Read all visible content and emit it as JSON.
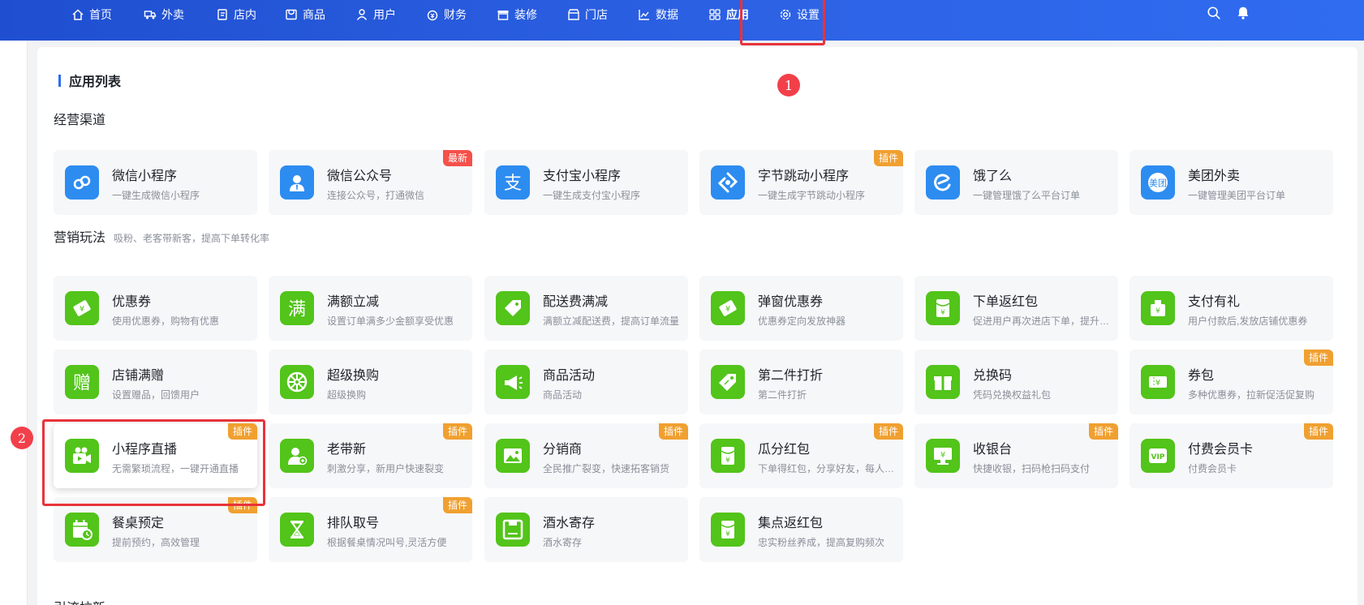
{
  "nav": {
    "items": [
      {
        "label": "首页",
        "icon": "home-icon"
      },
      {
        "label": "外卖",
        "icon": "delivery-icon"
      },
      {
        "label": "店内",
        "icon": "dine-in-icon"
      },
      {
        "label": "商品",
        "icon": "goods-icon"
      },
      {
        "label": "用户",
        "icon": "user-icon"
      },
      {
        "label": "财务",
        "icon": "finance-icon"
      },
      {
        "label": "装修",
        "icon": "decoration-icon"
      },
      {
        "label": "门店",
        "icon": "store-icon"
      },
      {
        "label": "数据",
        "icon": "chart-icon"
      },
      {
        "label": "应用",
        "icon": "apps-icon",
        "active": true
      },
      {
        "label": "设置",
        "icon": "settings-icon"
      }
    ],
    "right_icons": [
      "search-icon",
      "bell-icon"
    ]
  },
  "page": {
    "title": "应用列表"
  },
  "markers": [
    "1",
    "2"
  ],
  "sections": {
    "channels": {
      "title": "经营渠道",
      "subtitle": "",
      "cards": [
        {
          "title": "微信小程序",
          "desc": "一键生成微信小程序",
          "icon": "wechat-mini-program-icon",
          "tag": ""
        },
        {
          "title": "微信公众号",
          "desc": "连接公众号，打通微信",
          "icon": "wechat-official-account-icon",
          "tag": "最新"
        },
        {
          "title": "支付宝小程序",
          "desc": "一键生成支付宝小程序",
          "icon": "alipay-icon",
          "tag": ""
        },
        {
          "title": "字节跳动小程序",
          "desc": "一键生成字节跳动小程序",
          "icon": "bytedance-icon",
          "tag": "插件"
        },
        {
          "title": "饿了么",
          "desc": "一键管理饿了么平台订单",
          "icon": "eleme-icon",
          "tag": ""
        },
        {
          "title": "美团外卖",
          "desc": "一键管理美团平台订单",
          "icon": "meituan-icon",
          "tag": ""
        }
      ]
    },
    "marketing": {
      "title": "营销玩法",
      "subtitle": "吸粉、老客带新客，提高下单转化率",
      "cards": [
        {
          "title": "优惠券",
          "desc": "使用优惠券，购物有优惠",
          "icon": "coupon-icon",
          "tag": ""
        },
        {
          "title": "满额立减",
          "desc": "设置订单满多少金额享受优惠",
          "icon": "full-reduction-icon",
          "glyph": "满",
          "tag": ""
        },
        {
          "title": "配送费满减",
          "desc": "满额立减配送费，提高订单流量",
          "icon": "delivery-fee-tag-icon",
          "tag": ""
        },
        {
          "title": "弹窗优惠券",
          "desc": "优惠券定向发放神器",
          "icon": "popup-coupon-icon",
          "tag": ""
        },
        {
          "title": "下单返红包",
          "desc": "促进用户再次进店下单，提升复购率",
          "icon": "red-packet-icon",
          "tag": ""
        },
        {
          "title": "支付有礼",
          "desc": "用户付款后,发放店铺优惠券",
          "icon": "pay-gift-icon",
          "tag": ""
        },
        {
          "title": "店铺满赠",
          "desc": "设置赠品，回馈用户",
          "icon": "gift-glyph-icon",
          "glyph": "赠",
          "tag": ""
        },
        {
          "title": "超级换购",
          "desc": "超级换购",
          "icon": "wheel-icon",
          "tag": ""
        },
        {
          "title": "商品活动",
          "desc": "商品活动",
          "icon": "megaphone-icon",
          "tag": ""
        },
        {
          "title": "第二件打折",
          "desc": "第二件打折",
          "icon": "discount-tag-icon",
          "tag": ""
        },
        {
          "title": "兑换码",
          "desc": "凭码兑换权益礼包",
          "icon": "gift-box-icon",
          "tag": ""
        },
        {
          "title": "券包",
          "desc": "多种优惠券，拉新促活促复购",
          "icon": "coupon-pack-icon",
          "tag": "插件"
        },
        {
          "title": "小程序直播",
          "desc": "无需繁琐流程，一键开通直播",
          "icon": "live-camera-icon",
          "tag": "插件",
          "featured": true
        },
        {
          "title": "老带新",
          "desc": "刺激分享，新用户快速裂变",
          "icon": "invite-user-icon",
          "tag": "插件"
        },
        {
          "title": "分销商",
          "desc": "全民推广裂变，快速拓客销货",
          "icon": "image-icon",
          "tag": "插件"
        },
        {
          "title": "瓜分红包",
          "desc": "下单得红包，分享好友，每人可得红包",
          "icon": "red-packet-icon",
          "tag": "插件"
        },
        {
          "title": "收银台",
          "desc": "快捷收银，扫码枪扫码支付",
          "icon": "cashier-icon",
          "tag": "插件"
        },
        {
          "title": "付费会员卡",
          "desc": "付费会员卡",
          "icon": "vip-card-icon",
          "tag": "插件"
        },
        {
          "title": "餐桌预定",
          "desc": "提前预约，高效管理",
          "icon": "calendar-clock-icon",
          "tag": "插件"
        },
        {
          "title": "排队取号",
          "desc": "根据餐桌情况叫号,灵活方便",
          "icon": "hourglass-icon",
          "tag": "插件"
        },
        {
          "title": "酒水寄存",
          "desc": "酒水寄存",
          "icon": "storage-icon",
          "tag": ""
        },
        {
          "title": "集点返红包",
          "desc": "忠实粉丝养成，提高复购频次",
          "icon": "red-packet-icon",
          "tag": ""
        }
      ]
    },
    "next": {
      "title": "引流拉新"
    }
  },
  "colors": {
    "nav_bg": "#2558dc",
    "channel_icon": "#2d8cf0",
    "marketing_icon": "#52c41a",
    "tag_new": "#f5504a",
    "tag_plugin": "#f0a030",
    "highlight": "#e8333a"
  }
}
